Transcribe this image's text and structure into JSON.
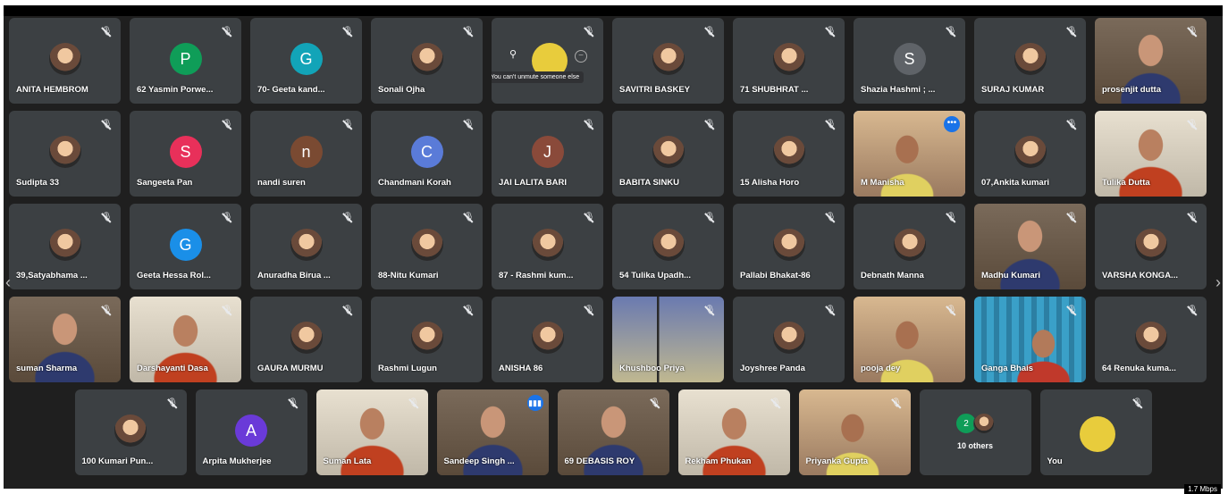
{
  "meeting": {
    "bitrate": "1.7 Mbps",
    "tooltip": "You can't unmute someone else",
    "rows": [
      [
        {
          "name": "ANITA HEMBROM",
          "avatar": "photo",
          "muted": true
        },
        {
          "name": "62 Yasmin Porwe...",
          "avatar": "letter",
          "letter": "P",
          "color": "#0f9d58",
          "muted": true
        },
        {
          "name": "70- Geeta kand...",
          "avatar": "letter",
          "letter": "G",
          "color": "#12a4b8",
          "muted": true
        },
        {
          "name": "Sonali Ojha",
          "avatar": "photo",
          "muted": true
        },
        {
          "name": "",
          "avatar": "presenter",
          "muted": true
        },
        {
          "name": "SAVITRI BASKEY",
          "avatar": "photo",
          "muted": true
        },
        {
          "name": "71 SHUBHRAT ...",
          "avatar": "photo",
          "muted": true
        },
        {
          "name": "Shazia Hashmi ; ...",
          "avatar": "letter",
          "letter": "S",
          "color": "#5f6368",
          "muted": true
        },
        {
          "name": "SURAJ KUMAR",
          "avatar": "photo",
          "muted": true
        },
        {
          "name": "prosenjit dutta",
          "avatar": "video-person",
          "muted": true
        }
      ],
      [
        {
          "name": "Sudipta 33",
          "avatar": "photo",
          "muted": true
        },
        {
          "name": "Sangeeta Pan",
          "avatar": "letter",
          "letter": "S",
          "color": "#e8305a",
          "muted": true
        },
        {
          "name": "nandi suren",
          "avatar": "letter",
          "letter": "n",
          "color": "#7a4a32",
          "muted": true
        },
        {
          "name": "Chandmani Korah",
          "avatar": "letter",
          "letter": "C",
          "color": "#5a7bd8",
          "muted": true
        },
        {
          "name": "JAI LALITA BARI",
          "avatar": "letter",
          "letter": "J",
          "color": "#8a4a3a",
          "muted": true
        },
        {
          "name": "BABITA SINKU",
          "avatar": "photo",
          "muted": true
        },
        {
          "name": "15 Alisha Horo",
          "avatar": "photo",
          "muted": true
        },
        {
          "name": "M Manisha",
          "avatar": "video-room",
          "muted": false,
          "active": true
        },
        {
          "name": "07,Ankita kumari",
          "avatar": "photo",
          "muted": true
        },
        {
          "name": "Tulika Dutta",
          "avatar": "video-light",
          "muted": true
        }
      ],
      [
        {
          "name": "39,Satyabhama ...",
          "avatar": "photo",
          "muted": true
        },
        {
          "name": "Geeta Hessa Rol...",
          "avatar": "letter",
          "letter": "G",
          "color": "#1a8fe8",
          "muted": true
        },
        {
          "name": "Anuradha Birua ...",
          "avatar": "photo",
          "muted": true
        },
        {
          "name": "88-Nitu Kumari",
          "avatar": "photo",
          "muted": true
        },
        {
          "name": "87 - Rashmi kum...",
          "avatar": "photo",
          "muted": true
        },
        {
          "name": "54 Tulika Upadh...",
          "avatar": "photo",
          "muted": true
        },
        {
          "name": "Pallabi Bhakat-86",
          "avatar": "photo",
          "muted": true
        },
        {
          "name": "Debnath Manna",
          "avatar": "photo",
          "muted": true
        },
        {
          "name": "Madhu Kumari",
          "avatar": "video-person",
          "muted": true
        },
        {
          "name": "VARSHA KONGA...",
          "avatar": "photo",
          "muted": true
        }
      ],
      [
        {
          "name": "suman Sharma",
          "avatar": "video-person",
          "muted": true
        },
        {
          "name": "Darshayanti Dasa",
          "avatar": "video-light",
          "muted": true
        },
        {
          "name": "GAURA MURMU",
          "avatar": "photo",
          "muted": true
        },
        {
          "name": "Rashmi Lugun",
          "avatar": "photo",
          "muted": true
        },
        {
          "name": "ANISHA 86",
          "avatar": "photo",
          "muted": true
        },
        {
          "name": "Khushboo Priya",
          "avatar": "video-window",
          "muted": true
        },
        {
          "name": "Joyshree Panda",
          "avatar": "photo",
          "muted": true
        },
        {
          "name": "pooja dey",
          "avatar": "video-room",
          "muted": true
        },
        {
          "name": "Ganga Bhais",
          "avatar": "video-curtain",
          "muted": true
        },
        {
          "name": "64 Renuka kuma...",
          "avatar": "photo",
          "muted": true
        }
      ],
      [
        {
          "name": "100 Kumari Pun...",
          "avatar": "photo",
          "muted": true
        },
        {
          "name": "Arpita Mukherjee",
          "avatar": "letter",
          "letter": "A",
          "color": "#6a3ad8",
          "muted": true
        },
        {
          "name": "Suman Lata",
          "avatar": "video-light",
          "muted": true
        },
        {
          "name": "Sandeep Singh ...",
          "avatar": "video-person",
          "muted": false,
          "speaking": true
        },
        {
          "name": "69 DEBASIS ROY",
          "avatar": "video-person",
          "muted": true
        },
        {
          "name": "Rekham Phukan",
          "avatar": "video-light",
          "muted": true
        },
        {
          "name": "Priyanka Gupta",
          "avatar": "video-room",
          "muted": true
        },
        {
          "name": "10 others",
          "avatar": "others",
          "others_count": "2",
          "muted": false
        },
        {
          "name": "You",
          "avatar": "you",
          "muted": true
        }
      ]
    ]
  }
}
